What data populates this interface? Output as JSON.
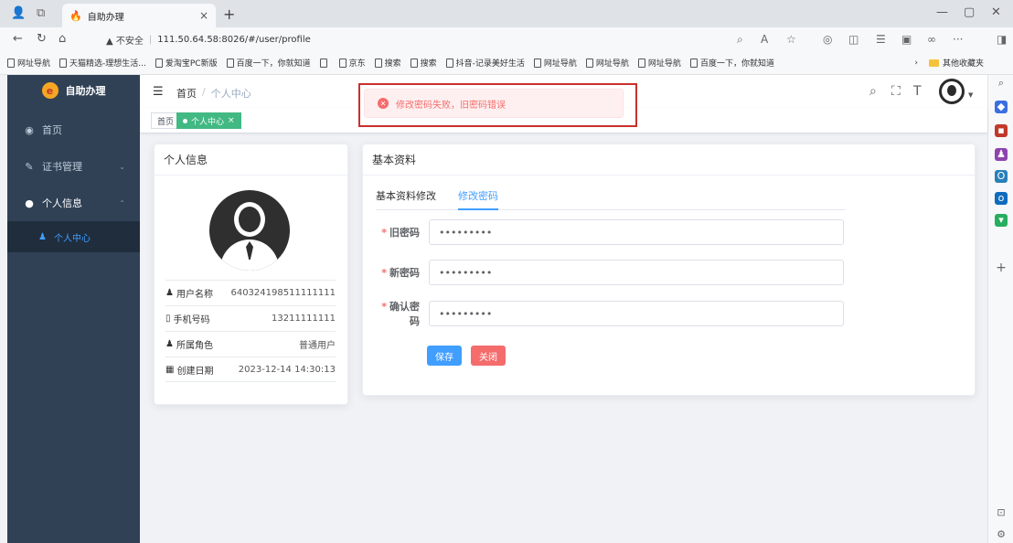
{
  "browser": {
    "tab_title": "自助办理",
    "tab_close": "×",
    "new_tab": "+",
    "url_warning": "▲ 不安全",
    "url": "111.50.64.58:8026/#/user/profile",
    "bookmarks": [
      "网址导航",
      "天猫精选-理想生活...",
      "爱淘宝PC新版",
      "百度一下，你就知道",
      "",
      "京东",
      "搜索",
      "搜索",
      "抖音-记录美好生活",
      "网址导航",
      "网址导航",
      "网址导航",
      "百度一下，你就知道"
    ],
    "other_bookmarks": "其他收藏夹"
  },
  "sidebar": {
    "logo_text": "自助办理",
    "items": [
      {
        "label": "首页",
        "icon": "dashboard-icon"
      },
      {
        "label": "证书管理",
        "icon": "edit-icon"
      },
      {
        "label": "个人信息",
        "icon": "user-icon"
      }
    ],
    "sub_item": {
      "label": "个人中心",
      "icon": "users-icon"
    }
  },
  "header": {
    "breadcrumb_home": "首页",
    "breadcrumb_sep": "/",
    "breadcrumb_current": "个人中心"
  },
  "tags": {
    "home": "首页",
    "current": "个人中心",
    "close": "×"
  },
  "profile": {
    "title": "个人信息",
    "rows": [
      {
        "label": "用户名称",
        "value": "640324198511111111"
      },
      {
        "label": "手机号码",
        "value": "13211111111"
      },
      {
        "label": "所属角色",
        "value": "普通用户"
      },
      {
        "label": "创建日期",
        "value": "2023-12-14 14:30:13"
      }
    ]
  },
  "basic": {
    "title": "基本资料",
    "tabs": [
      "基本资料修改",
      "修改密码"
    ],
    "fields": [
      {
        "label": "旧密码",
        "value": "•••••••••"
      },
      {
        "label": "新密码",
        "value": "•••••••••"
      },
      {
        "label": "确认密码",
        "value": "•••••••••"
      }
    ],
    "save_label": "保存",
    "close_label": "关闭"
  },
  "toast": {
    "message": "修改密码失败，旧密码错误"
  },
  "colors": {
    "sidebar_bg": "#304156",
    "primary": "#409eff",
    "danger": "#f56c6c",
    "tag_active": "#42b983"
  }
}
